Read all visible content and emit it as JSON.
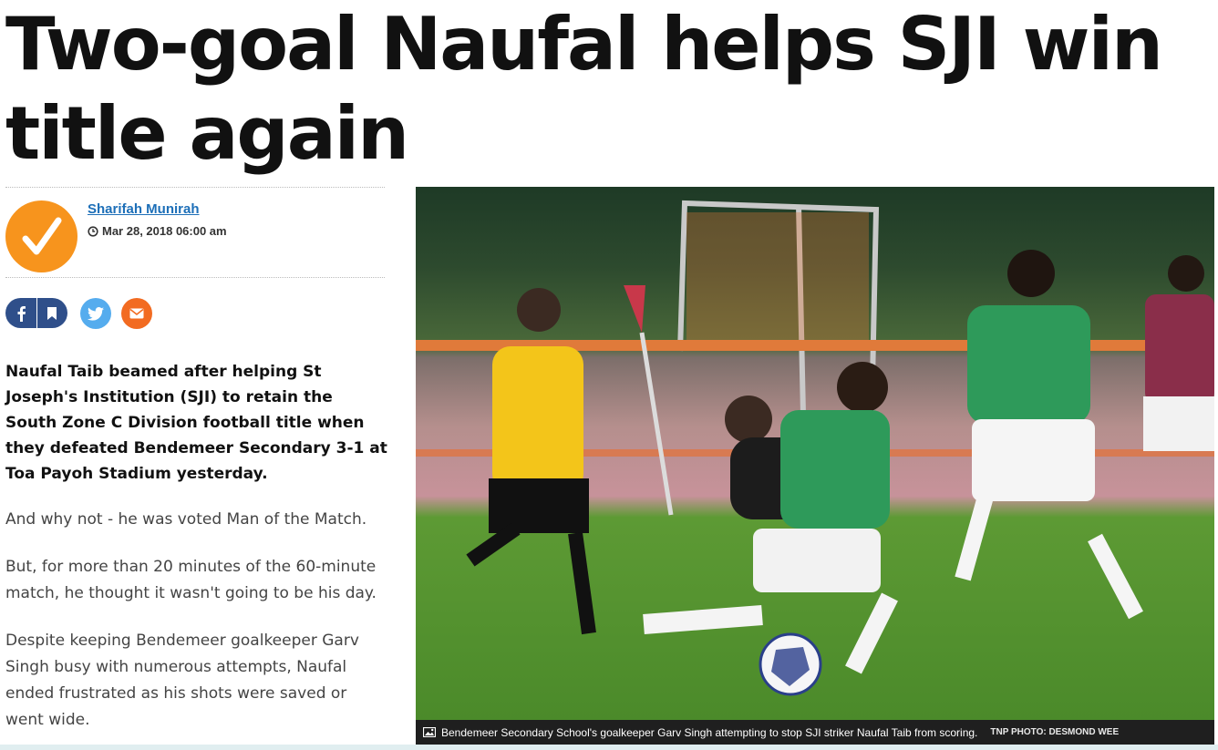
{
  "article": {
    "headline": "Two-goal Naufal helps SJI win title again",
    "author": "Sharifah Munirah",
    "date": "Mar 28, 2018 06:00 am",
    "lede": "Naufal Taib beamed after helping St Joseph's Institution (SJI) to retain the South Zone C Division football title when they defeated Bendemeer Secondary 3-1 at Toa Payoh Stadium yesterday.",
    "paragraphs": [
      "And why not - he was voted Man of the Match.",
      "But, for more than 20 minutes of the 60-minute match, he thought it wasn't going to be his day.",
      "Despite keeping Bendemeer goalkeeper Garv Singh busy with numerous attempts, Naufal ended frustrated as his shots were saved or went wide."
    ]
  },
  "share": {
    "buttons": [
      {
        "name": "facebook",
        "icon": "facebook-icon",
        "color": "#2f4f8a"
      },
      {
        "name": "bookmark",
        "icon": "bookmark-icon",
        "color": "#2f4f8a"
      },
      {
        "name": "twitter",
        "icon": "twitter-icon",
        "color": "#55acee"
      },
      {
        "name": "email",
        "icon": "email-icon",
        "color": "#f26b21"
      }
    ]
  },
  "photo": {
    "caption": "Bendemeer Secondary School's goalkeeper Garv Singh attempting to stop SJI striker Naufal Taib from scoring.",
    "credit": "TNP PHOTO: DESMOND WEE"
  },
  "colors": {
    "author_link": "#1d6fb8",
    "avatar_bg": "#f7941d"
  }
}
